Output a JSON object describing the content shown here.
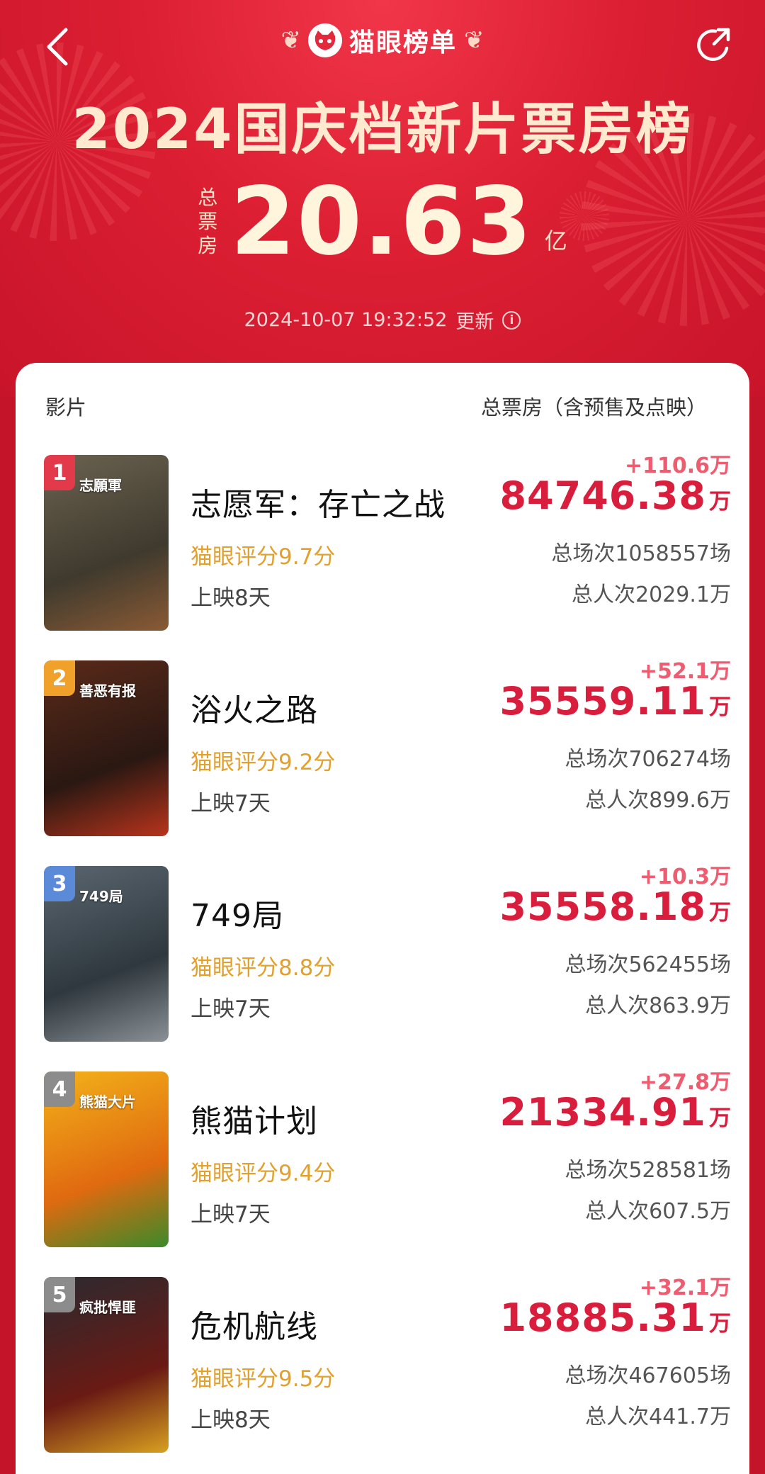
{
  "header": {
    "brand": "猫眼榜单",
    "title": "2024国庆档新片票房榜",
    "total_label_chars": [
      "总",
      "票",
      "房"
    ],
    "total_value": "20.63",
    "total_unit": "亿",
    "update_time": "2024-10-07  19:32:52",
    "update_label": "更新",
    "info_symbol": "i"
  },
  "table": {
    "col_left": "影片",
    "col_right": "总票房（含预售及点映）"
  },
  "colors": {
    "accent": "#d81e3c",
    "increase": "#ef5c70",
    "score": "#e2a02d",
    "header_red": "#dc1f33"
  },
  "films": [
    {
      "rank": "1",
      "name": "志愿军：存亡之战",
      "score": "猫眼评分9.7分",
      "days": "上映8天",
      "increase": "+110.6万",
      "box": "84746.38",
      "unit": "万",
      "sessions": "总场次1058557场",
      "people": "总人次2029.1万",
      "poster_text": "志願軍",
      "rank_color": "#e23a4a",
      "poster_colors": [
        "#6b6250",
        "#3f3a2e",
        "#8a5a34"
      ]
    },
    {
      "rank": "2",
      "name": "浴火之路",
      "score": "猫眼评分9.2分",
      "days": "上映7天",
      "increase": "+52.1万",
      "box": "35559.11",
      "unit": "万",
      "sessions": "总场次706274场",
      "people": "总人次899.6万",
      "poster_text": "善恶有报",
      "rank_color": "#f0a12a",
      "poster_colors": [
        "#5a2a1a",
        "#2a1812",
        "#b8341c"
      ]
    },
    {
      "rank": "3",
      "name": "749局",
      "score": "猫眼评分8.8分",
      "days": "上映7天",
      "increase": "+10.3万",
      "box": "35558.18",
      "unit": "万",
      "sessions": "总场次562455场",
      "people": "总人次863.9万",
      "poster_text": "749局",
      "rank_color": "#5a8ad8",
      "poster_colors": [
        "#5a6670",
        "#2f383e",
        "#8a9096"
      ]
    },
    {
      "rank": "4",
      "name": "熊猫计划",
      "score": "猫眼评分9.4分",
      "days": "上映7天",
      "increase": "+27.8万",
      "box": "21334.91",
      "unit": "万",
      "sessions": "总场次528581场",
      "people": "总人次607.5万",
      "poster_text": "熊猫大片",
      "rank_color": "#8c8c8c",
      "poster_colors": [
        "#f2b21a",
        "#e06a10",
        "#3a8a2a"
      ]
    },
    {
      "rank": "5",
      "name": "危机航线",
      "score": "猫眼评分9.5分",
      "days": "上映8天",
      "increase": "+32.1万",
      "box": "18885.31",
      "unit": "万",
      "sessions": "总场次467605场",
      "people": "总人次441.7万",
      "poster_text": "疯批悍匪",
      "rank_color": "#8c8c8c",
      "poster_colors": [
        "#2a2a30",
        "#6a1a14",
        "#d8a020"
      ]
    }
  ]
}
